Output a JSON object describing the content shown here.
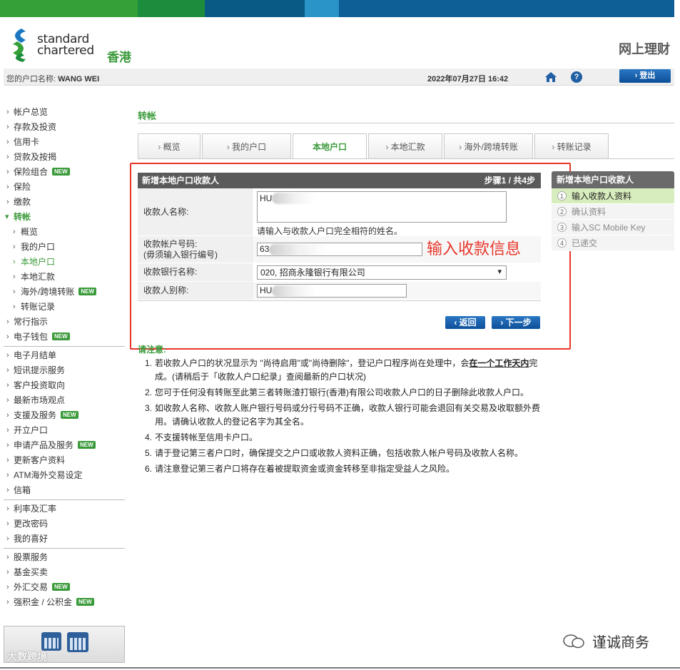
{
  "colors": {
    "stripe": [
      "#35a037",
      "#1c8d3c",
      "#0a5a86",
      "#2a93c8",
      "#0f5f97"
    ],
    "accent_green": "#3a9a3a",
    "button_blue": "#0d4f98",
    "annotation_red": "#e8352a"
  },
  "header": {
    "logo_line1": "standard",
    "logo_line2": "chartered",
    "logo_region": "香港",
    "service_name": "网上理财"
  },
  "userbar": {
    "account_label": "您的户口名称:",
    "account_name": "WANG WEI",
    "datetime": "2022年07月27日 16:42",
    "home_icon": "home-icon",
    "help_icon": "help-icon",
    "help_glyph": "?",
    "logout_label": "› 登出"
  },
  "leftnav": {
    "group1": [
      {
        "label": "帐户总览"
      },
      {
        "label": "存款及投资"
      },
      {
        "label": "信用卡"
      },
      {
        "label": "贷款及按揭"
      },
      {
        "label": "保险组合",
        "badge": "NEW"
      },
      {
        "label": "保险"
      },
      {
        "label": "缴款"
      }
    ],
    "active": "转帐",
    "sub": [
      {
        "label": "概览"
      },
      {
        "label": "我的户口"
      },
      {
        "label": "本地户口"
      },
      {
        "label": "本地汇款"
      },
      {
        "label": "海外/跨境转账",
        "badge": "NEW"
      },
      {
        "label": "转账记录"
      }
    ],
    "group2": [
      {
        "label": "常行指示"
      },
      {
        "label": "电子钱包",
        "badge": "NEW"
      }
    ],
    "group3": [
      {
        "label": "电子月结单"
      },
      {
        "label": "短讯提示服务"
      },
      {
        "label": "客户投资取向"
      },
      {
        "label": "最新市场观点"
      },
      {
        "label": "支援及服务",
        "badge": "NEW"
      },
      {
        "label": "开立户口"
      },
      {
        "label": "申请产品及服务",
        "badge": "NEW"
      },
      {
        "label": "更新客户资料"
      },
      {
        "label": "ATM海外交易设定"
      },
      {
        "label": "信箱"
      }
    ],
    "group4": [
      {
        "label": "利率及汇率"
      },
      {
        "label": "更改密码"
      },
      {
        "label": "我的喜好"
      }
    ],
    "group5": [
      {
        "label": "股票服务"
      },
      {
        "label": "基金买卖"
      },
      {
        "label": "外汇交易",
        "badge": "NEW"
      },
      {
        "label": "强积金 / 公积金",
        "badge": "NEW"
      }
    ],
    "watermark": "大数跨境"
  },
  "main": {
    "section_title": "转帐",
    "tabs": [
      {
        "label": "概览"
      },
      {
        "label": "我的户口"
      },
      {
        "label": "本地户口"
      },
      {
        "label": "本地汇款"
      },
      {
        "label": "海外/跨境转账"
      },
      {
        "label": "转账记录"
      }
    ],
    "form": {
      "title": "新增本地户口收款人",
      "step": "步骤1 / 共4步",
      "name_label": "收款人名称:",
      "name_value": "HU",
      "name_hint": "请输入与收款人户口完全相符的姓名。",
      "account_label_1": "收款帐户号码:",
      "account_label_2": "(毋须输入银行编号)",
      "account_value": "63",
      "bank_label": "收款银行名称:",
      "bank_value": "020, 招商永隆银行有限公司",
      "nickname_label": "收款人别称:",
      "nickname_value": "HU",
      "back_label": "‹ 返回",
      "next_label": "› 下一步"
    },
    "annotation": "输入收款信息"
  },
  "steps": {
    "title": "新增本地户口收款人",
    "items": [
      {
        "num": "1",
        "label": "输入收款人资料"
      },
      {
        "num": "2",
        "label": "确认资料"
      },
      {
        "num": "3",
        "label": "输入SC Mobile Key"
      },
      {
        "num": "4",
        "label": "已递交"
      }
    ]
  },
  "notes": {
    "title": "请注意:",
    "items": [
      {
        "n": "1.",
        "pre": "若收款人户口的状况显示为 \"尚待启用\"或\"尚待删除\"，登记户口程序尚在处理中，会",
        "em": "在一个工作天内",
        "post": "完成。(请稍后于「收款人户口纪录」查阅最新的户口状况)"
      },
      {
        "n": "2.",
        "pre": "您可于任何没有转账至此第三者转账渣打银行(香港)有限公司收款人户口的日子删除此收款人户口。",
        "em": "",
        "post": ""
      },
      {
        "n": "3.",
        "pre": "如收款人名称、收款人账户银行号码或分行号码不正确，收款人银行可能会退回有关交易及收取额外费用。请确认收款人的登记名字为其全名。",
        "em": "",
        "post": ""
      },
      {
        "n": "4.",
        "pre": "不支援转帐至信用卡户口。",
        "em": "",
        "post": ""
      },
      {
        "n": "5.",
        "pre": "请于登记第三者户口时，确保提交之户口或收款人资料正确，包括收款人帐户号码及收款人名称。",
        "em": "",
        "post": ""
      },
      {
        "n": "6.",
        "pre": "请注意登记第三者户口将存在着被提取资金或资金转移至非指定受益人之风险。",
        "em": "",
        "post": ""
      }
    ]
  },
  "watermark_right": "谨诚商务"
}
